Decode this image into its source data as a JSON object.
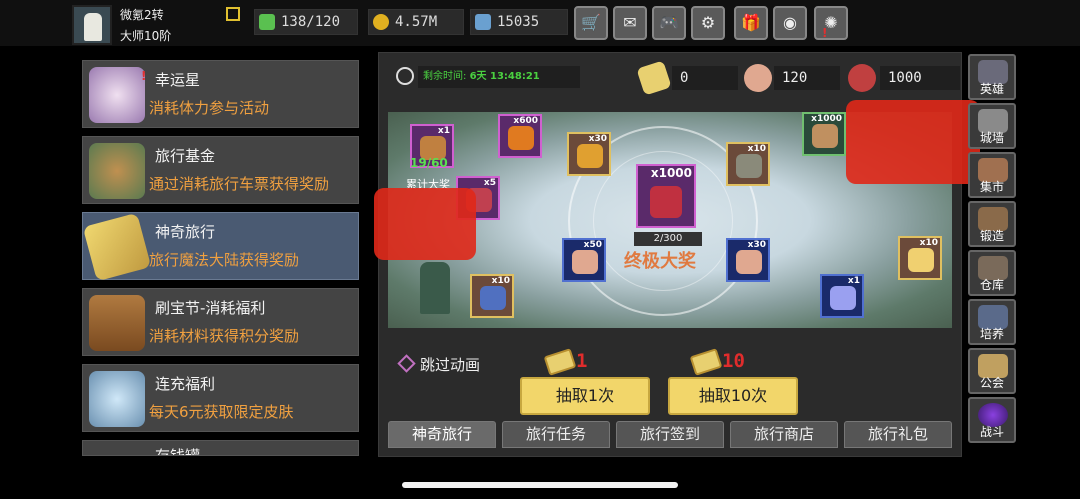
{
  "player": {
    "name": "微氪2转",
    "rank": "大师10阶"
  },
  "resources": {
    "stamina": "138/120",
    "gold": "4.57M",
    "gems": "15035"
  },
  "top_buttons": [
    {
      "icon": "cart-icon",
      "glyph": "🛒"
    },
    {
      "icon": "mail-icon",
      "glyph": "✉"
    },
    {
      "icon": "gamepad-icon",
      "glyph": "🎮"
    },
    {
      "icon": "gear-icon",
      "glyph": "⚙"
    },
    {
      "icon": "gift-icon",
      "glyph": "🎁"
    },
    {
      "icon": "color-wheel-icon",
      "glyph": "◉"
    },
    {
      "icon": "sparkle-icon",
      "glyph": "✺"
    }
  ],
  "events": [
    {
      "title": "幸运星",
      "desc": "消耗体力参与活动"
    },
    {
      "title": "旅行基金",
      "desc": "通过消耗旅行车票获得奖励"
    },
    {
      "title": "神奇旅行",
      "desc": "旅行魔法大陆获得奖励"
    },
    {
      "title": "刷宝节-消耗福利",
      "desc": "消耗材料获得积分奖励"
    },
    {
      "title": "连充福利",
      "desc": "每天6元获取限定皮肤"
    },
    {
      "title": "存钱罐"
    }
  ],
  "panel": {
    "timer_label": "剩余时间:",
    "timer_value": "6天 13:48:21",
    "currencies": {
      "tickets": "0",
      "pouch": "120",
      "bag": "1000"
    }
  },
  "map": {
    "cumulative_progress": "19/60",
    "cumulative_label": "累计大奖",
    "grand_count": "x1000",
    "grand_progress": "2/300",
    "grand_label": "终极大奖",
    "slots": [
      {
        "count": "x1",
        "kind": "treasure-chest"
      },
      {
        "count": "x600",
        "kind": "fire-shard"
      },
      {
        "count": "x30",
        "kind": "orange-gem"
      },
      {
        "count": "x1000",
        "kind": "bone"
      },
      {
        "count": "x5",
        "kind": "pouch"
      },
      {
        "count": "x10",
        "kind": "hammer"
      },
      {
        "count": "x50",
        "kind": "pouch"
      },
      {
        "count": "x30",
        "kind": "pouch"
      },
      {
        "count": "x10",
        "kind": "blue-ore"
      },
      {
        "count": "x10",
        "kind": "crystal"
      },
      {
        "count": "x1",
        "kind": "star-gem"
      }
    ]
  },
  "skip_label": "跳过动画",
  "draw": {
    "one_cost": "1",
    "one_label": "抽取1次",
    "ten_cost": "10",
    "ten_label": "抽取10次"
  },
  "tabs": [
    "神奇旅行",
    "旅行任务",
    "旅行签到",
    "旅行商店",
    "旅行礼包"
  ],
  "right_nav": [
    "英雄",
    "城墙",
    "集市",
    "锻造",
    "仓库",
    "培养",
    "公会",
    "战斗"
  ]
}
